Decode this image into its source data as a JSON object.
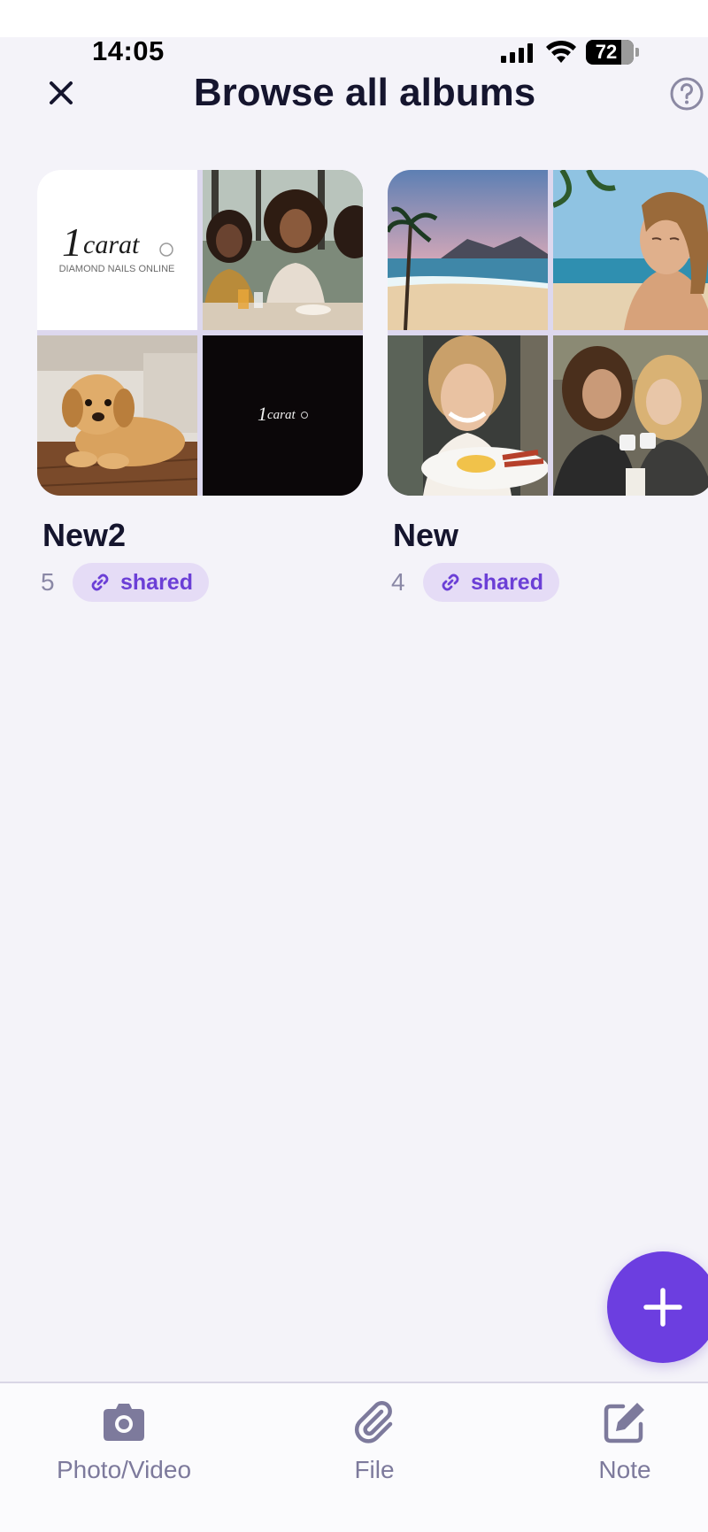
{
  "status": {
    "time": "14:05",
    "battery": "72"
  },
  "header": {
    "title": "Browse all albums",
    "close_icon": "close-icon",
    "help_icon": "help-icon"
  },
  "albums": [
    {
      "name": "New2",
      "count": "5",
      "badge": "shared",
      "logo_text": "1carat",
      "logo_subtext": "DIAMOND NAILS ONLINE"
    },
    {
      "name": "New",
      "count": "4",
      "badge": "shared"
    }
  ],
  "fab": {
    "icon": "plus-icon"
  },
  "bottom_bar": {
    "tabs": [
      {
        "label": "Photo/Video",
        "icon": "camera-icon"
      },
      {
        "label": "File",
        "icon": "paperclip-icon"
      },
      {
        "label": "Note",
        "icon": "edit-note-icon"
      }
    ]
  },
  "colors": {
    "accent": "#6c3ee0",
    "badge_bg": "#e5dcf6",
    "badge_text": "#6b3fd6",
    "background": "#f4f3f9"
  }
}
